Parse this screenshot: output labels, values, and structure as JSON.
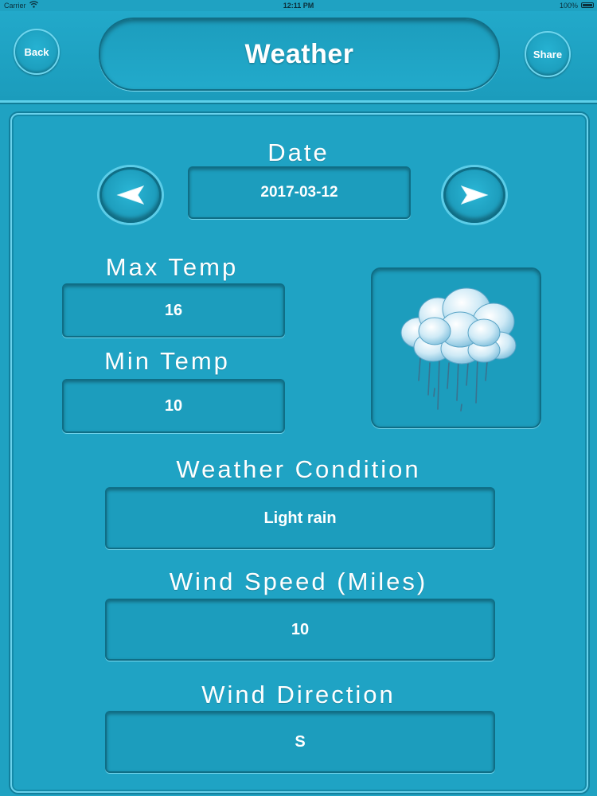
{
  "status_bar": {
    "carrier": "Carrier",
    "time": "12:11 PM",
    "battery": "100%"
  },
  "header": {
    "title": "Weather",
    "back_label": "Back",
    "share_label": "Share"
  },
  "date": {
    "label": "Date",
    "value": "2017-03-12"
  },
  "max_temp": {
    "label": "Max Temp",
    "value": "16"
  },
  "min_temp": {
    "label": "Min Temp",
    "value": "10"
  },
  "condition": {
    "label": "Weather Condition",
    "value": "Light rain",
    "icon": "rain-cloud-icon"
  },
  "wind_speed": {
    "label": "Wind Speed (Miles)",
    "value": "10"
  },
  "wind_direction": {
    "label": "Wind Direction",
    "value": "S"
  },
  "colors": {
    "background": "#1fa2c2",
    "border_light": "#6ad2ec",
    "border_dark": "#0f6e86",
    "text": "#ffffff"
  }
}
